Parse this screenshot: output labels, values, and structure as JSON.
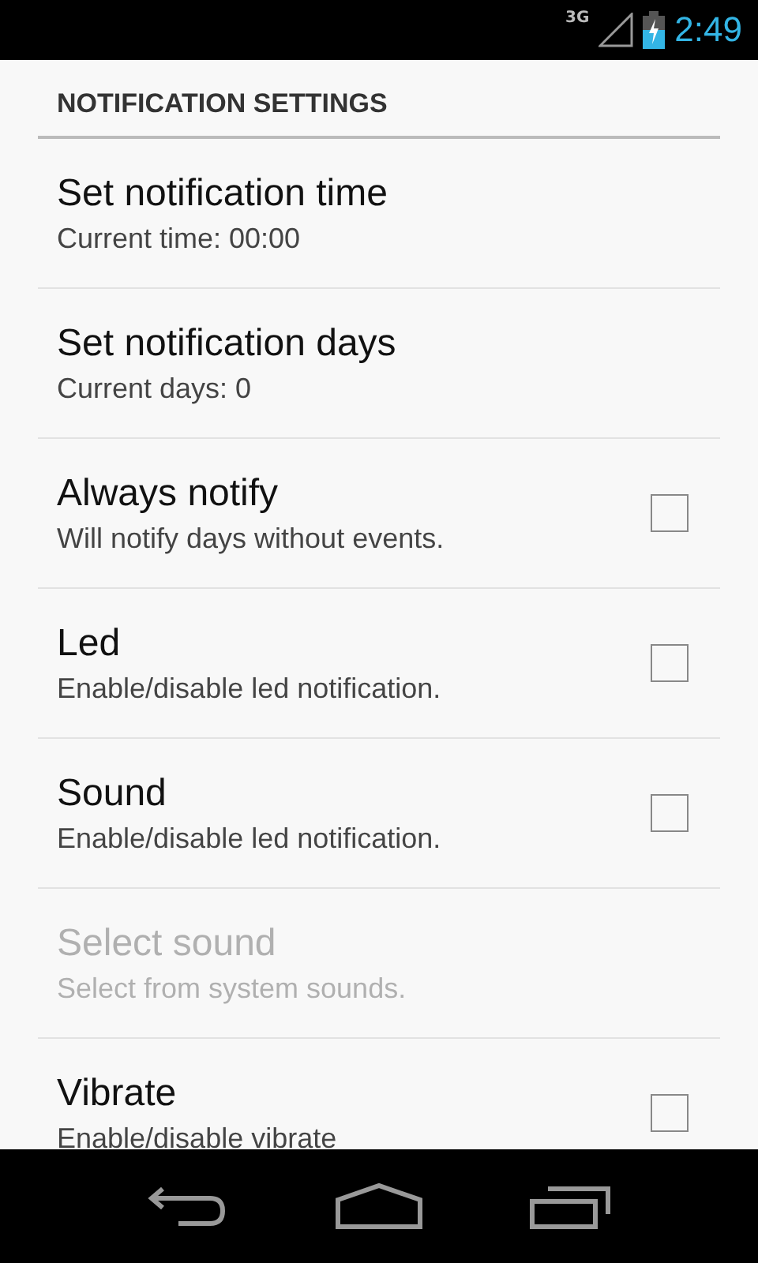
{
  "status_bar": {
    "network": "3G",
    "time": "2:49"
  },
  "category": {
    "title": "NOTIFICATION SETTINGS"
  },
  "preferences": [
    {
      "kind": "plain",
      "title": "Set notification time",
      "summary": "Current time: 00:00",
      "disabled": false
    },
    {
      "kind": "plain",
      "title": "Set notification days",
      "summary": "Current days: 0",
      "disabled": false
    },
    {
      "kind": "checkbox",
      "title": "Always notify",
      "summary": "Will notify days without events.",
      "disabled": false,
      "checked": false
    },
    {
      "kind": "checkbox",
      "title": "Led",
      "summary": "Enable/disable led notification.",
      "disabled": false,
      "checked": false
    },
    {
      "kind": "checkbox",
      "title": "Sound",
      "summary": "Enable/disable led notification.",
      "disabled": false,
      "checked": false
    },
    {
      "kind": "plain",
      "title": "Select sound",
      "summary": "Select from system sounds.",
      "disabled": true
    },
    {
      "kind": "checkbox",
      "title": "Vibrate",
      "summary": "Enable/disable vibrate",
      "disabled": false,
      "checked": false
    }
  ]
}
